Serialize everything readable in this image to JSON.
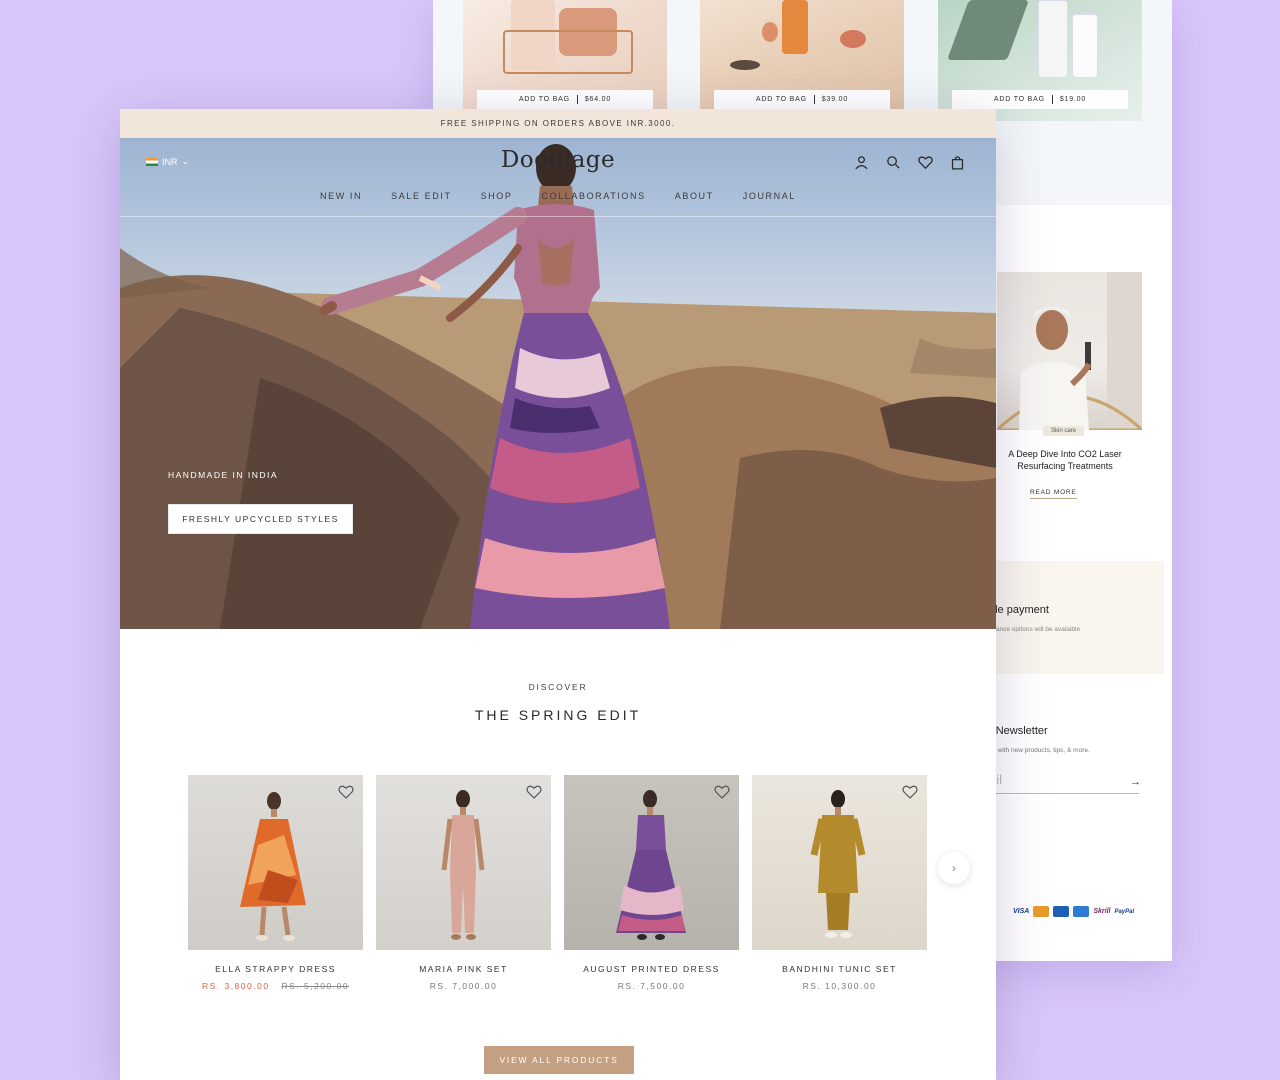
{
  "colors": {
    "background": "#d9c6fb",
    "announcement_bg": "#f1e6d9",
    "accent_button": "#c3a082",
    "sale_price": "#e0603d"
  },
  "beauty_site": {
    "products": [
      {
        "add_label": "ADD TO BAG",
        "price": "$64.00"
      },
      {
        "add_label": "ADD TO BAG",
        "price": "$39.00"
      },
      {
        "add_label": "ADD TO BAG",
        "price": "$19.00"
      }
    ],
    "blog": {
      "tag": "Skin care",
      "title": "A Deep Dive Into CO2 Laser Resurfacing Treatments",
      "read_more": "READ MORE"
    },
    "payment": {
      "title": "ble payment",
      "subtitle": "finance opitons will be available"
    },
    "newsletter": {
      "title": "r Newsletter",
      "subtitle": "ve with new products, tips, & more.",
      "placeholder": "ail"
    },
    "payment_methods": [
      "VISA",
      "Skrill",
      "PayPal"
    ]
  },
  "shop": {
    "announcement": "FREE SHIPPING ON ORDERS ABOVE INR.3000.",
    "currency": "INR",
    "logo": "Doodlage",
    "nav": [
      "NEW IN",
      "SALE EDIT",
      "SHOP",
      "COLLABORATIONS",
      "ABOUT",
      "JOURNAL"
    ],
    "icons": [
      "account-icon",
      "search-icon",
      "heart-icon",
      "bag-icon"
    ],
    "hero": {
      "eyebrow": "HANDMADE IN INDIA",
      "button": "FRESHLY UPCYCLED STYLES"
    },
    "section": {
      "eyebrow": "DISCOVER",
      "title": "THE SPRING EDIT"
    },
    "products": [
      {
        "name": "ELLA STRAPPY DRESS",
        "price": "RS. 3,800.00",
        "compare_price": "RS. 5,200.00"
      },
      {
        "name": "MARIA PINK SET",
        "price": "RS. 7,000.00"
      },
      {
        "name": "AUGUST PRINTED DRESS",
        "price": "RS. 7,500.00"
      },
      {
        "name": "BANDHINI TUNIC SET",
        "price": "RS. 10,300.00"
      }
    ],
    "view_all": "VIEW ALL PRODUCTS"
  }
}
